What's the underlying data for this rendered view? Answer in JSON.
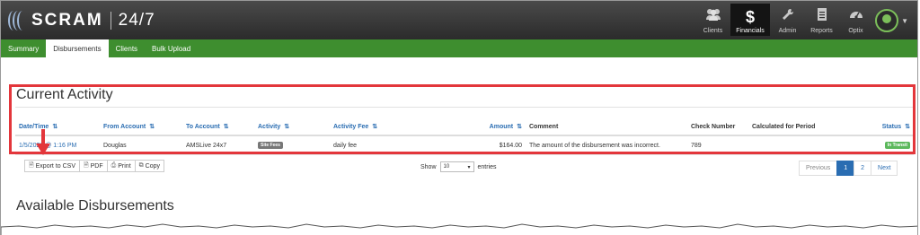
{
  "header": {
    "brand": "SCRAM",
    "brand_suffix": "24/7",
    "nav": [
      {
        "label": "Clients",
        "icon": "clients-icon"
      },
      {
        "label": "Financials",
        "icon": "dollar-icon"
      },
      {
        "label": "Admin",
        "icon": "wrench-icon"
      },
      {
        "label": "Reports",
        "icon": "report-icon"
      },
      {
        "label": "Optix",
        "icon": "dashboard-icon"
      }
    ],
    "active_nav": "Financials"
  },
  "subnav": [
    {
      "label": "Summary"
    },
    {
      "label": "Disbursements"
    },
    {
      "label": "Clients"
    },
    {
      "label": "Bulk Upload"
    }
  ],
  "current_activity": {
    "title": "Current Activity",
    "columns": [
      "Date/Time",
      "From Account",
      "To Account",
      "Activity",
      "Activity Fee",
      "Amount",
      "Comment",
      "Check Number",
      "Calculated for Period",
      "Status"
    ],
    "row": {
      "date_time": "1/5/2021 @ 1:16 PM",
      "from_account": "Douglas",
      "to_account": "AMSLive 24x7",
      "activity": "Site Fees",
      "activity_fee": "daily fee",
      "amount": "$164.00",
      "comment": "The amount of the disbursement was incorrect.",
      "check_number": "789",
      "calculated_for_period": "",
      "status": "In Transit"
    }
  },
  "toolbar": {
    "export_csv": "Export to CSV",
    "pdf": "PDF",
    "print": "Print",
    "copy": "Copy"
  },
  "entries": {
    "show_label": "Show",
    "value": "10",
    "entries_label": "entries"
  },
  "pagination": {
    "previous": "Previous",
    "pages": [
      "1",
      "2"
    ],
    "active_page": "1",
    "next": "Next"
  },
  "available": {
    "title": "Available Disbursements"
  },
  "colors": {
    "topbar": "#2b2b2b",
    "subnav": "#3e8e2f",
    "highlight": "#e3363b",
    "link": "#2a6db2",
    "status_green": "#5cb85c"
  }
}
